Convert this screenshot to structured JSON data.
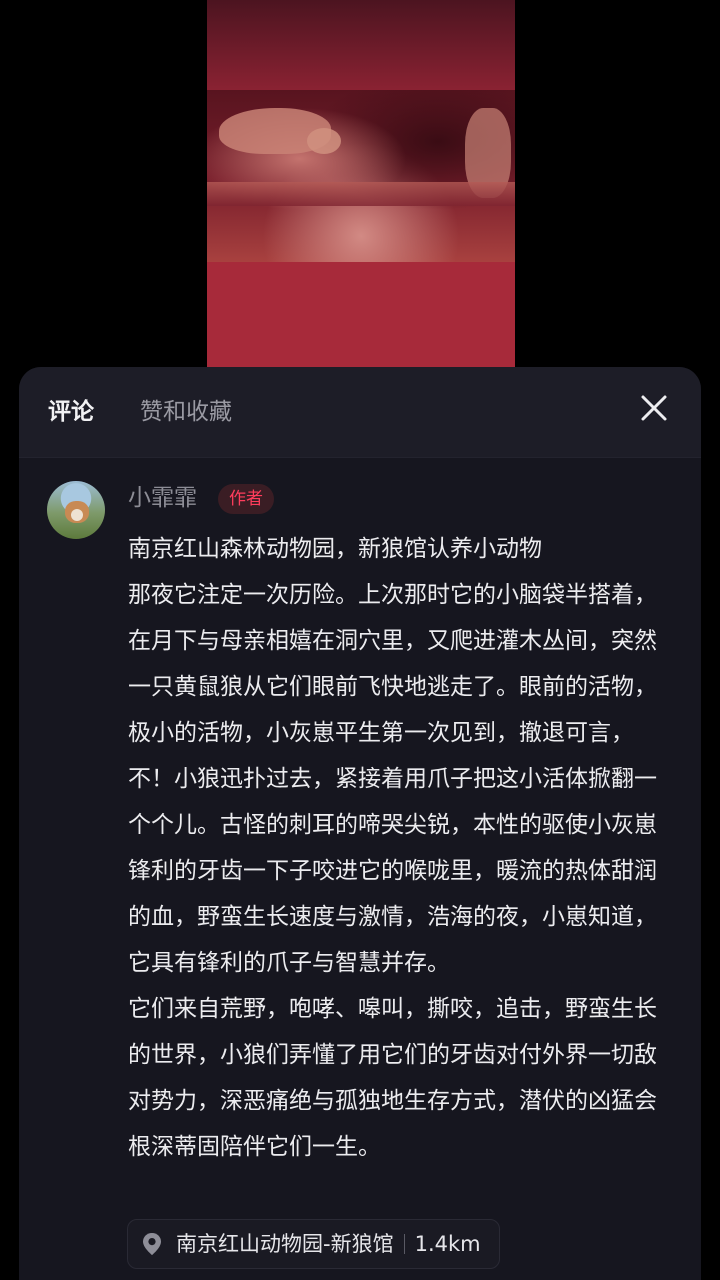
{
  "sheet": {
    "tabs": [
      {
        "label": "评论"
      },
      {
        "label": "赞和收藏"
      }
    ]
  },
  "comment": {
    "username": "小霏霏",
    "badge": "作者",
    "paragraphs": [
      "南京红山森林动物园，新狼馆认养小动物",
      "那夜它注定一次历险。上次那时它的小脑袋半搭着，在月下与母亲相嬉在洞穴里，又爬进灌木丛间，突然一只黄鼠狼从它们眼前飞快地逃走了。眼前的活物，极小的活物，小灰崽平生第一次见到，撤退可言，不！小狼迅扑过去，紧接着用爪子把这小活体掀翻一个个儿。古怪的刺耳的啼哭尖锐，本性的驱使小灰崽锋利的牙齿一下子咬进它的喉咙里，暖流的热体甜润的血，野蛮生长速度与激情，浩海的夜，小崽知道，它具有锋利的爪子与智慧并存。",
      "它们来自荒野，咆哮、嗥叫，撕咬，追击，野蛮生长的世界，小狼们弄懂了用它们的牙齿对付外界一切敌对势力，深恶痛绝与孤独地生存方式，潜伏的凶猛会根深蒂固陪伴它们一生。"
    ],
    "location": {
      "name": "南京红山动物园-新狼馆",
      "distance": "1.4km"
    }
  },
  "colors": {
    "sheet_bg": "#16161f",
    "header_bg": "#1d1d27",
    "badge_text": "#ff3d5c",
    "video_tint": "#a2283a"
  },
  "icons": {
    "close": "close-icon",
    "location": "location-pin-icon"
  }
}
